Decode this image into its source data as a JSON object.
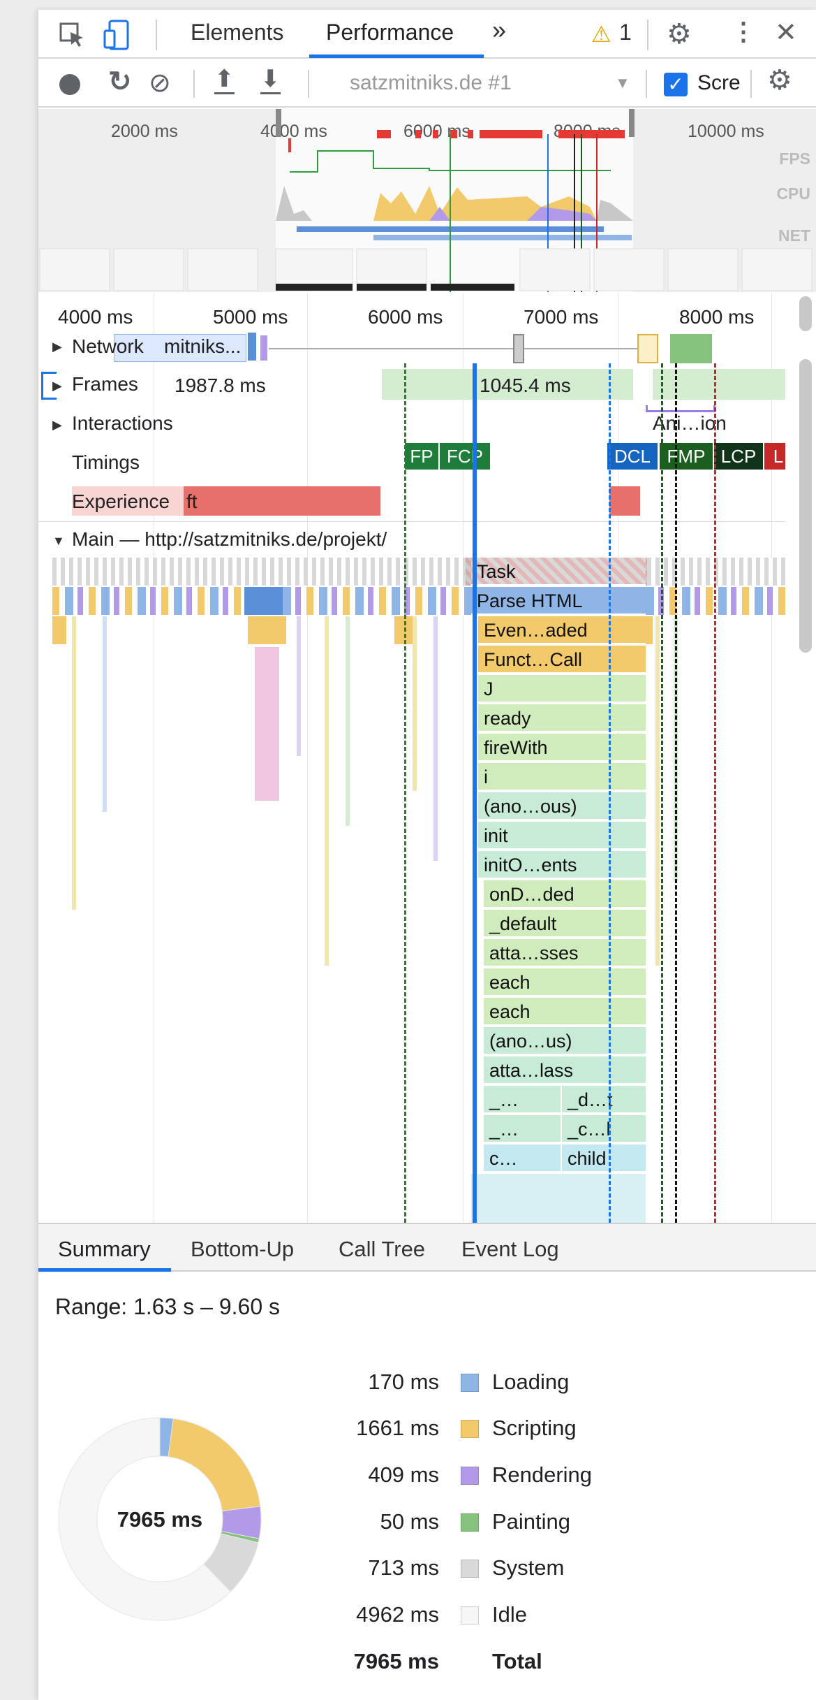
{
  "tabs": {
    "elements": "Elements",
    "performance": "Performance",
    "more": "»",
    "warning_count": "1"
  },
  "toolbar": {
    "recording_select": "satzmitniks.de #1",
    "screenshots_label": "Scre"
  },
  "overview": {
    "ticks": [
      "2000 ms",
      "4000 ms",
      "6000 ms",
      "8000 ms",
      "10000 ms"
    ],
    "lanes": [
      "FPS",
      "CPU",
      "NET"
    ]
  },
  "ruler": {
    "ticks": [
      "4000 ms",
      "5000 ms",
      "6000 ms",
      "7000 ms",
      "8000 ms"
    ]
  },
  "tracks": {
    "network": "Network",
    "network_item": "mitniks...",
    "frames": "Frames",
    "frames_value_1": "1987.8 ms",
    "frames_value_2": "1045.4 ms",
    "interactions": "Interactions",
    "interactions_item": "Ani…ion",
    "timings": "Timings",
    "experience": "Experience",
    "experience_item": "ft",
    "main": "Main — http://satzmitniks.de/projekt/"
  },
  "timing_markers": [
    "FP",
    "FCP",
    "DCL",
    "FMP",
    "LCP",
    "L"
  ],
  "call_stack": [
    "Task",
    "Parse HTML",
    "Even…aded",
    "Funct…Call",
    "J",
    "ready",
    "fireWith",
    "i",
    "(ano…ous)",
    "init",
    "initO…ents",
    "onD…ded",
    "_default",
    "atta…sses",
    "each",
    "each",
    "(ano…us)",
    "atta…lass",
    "_…",
    "_d…t",
    "_…",
    "_c…l",
    "c…",
    "child"
  ],
  "bottom_tabs": [
    "Summary",
    "Bottom-Up",
    "Call Tree",
    "Event Log"
  ],
  "summary": {
    "range": "Range: 1.63 s – 9.60 s",
    "total_center": "7965 ms",
    "rows": [
      {
        "value": "170 ms",
        "name": "Loading",
        "color": "#8fb5e6"
      },
      {
        "value": "1661 ms",
        "name": "Scripting",
        "color": "#f2ca6b"
      },
      {
        "value": "409 ms",
        "name": "Rendering",
        "color": "#b39ae9"
      },
      {
        "value": "50 ms",
        "name": "Painting",
        "color": "#85c27d"
      },
      {
        "value": "713 ms",
        "name": "System",
        "color": "#d9d9d9"
      },
      {
        "value": "4962 ms",
        "name": "Idle",
        "color": "#f6f6f6"
      }
    ],
    "total_value": "7965 ms",
    "total_label": "Total"
  },
  "chart_data": {
    "type": "pie",
    "categories": [
      "Loading",
      "Scripting",
      "Rendering",
      "Painting",
      "System",
      "Idle"
    ],
    "values": [
      170,
      1661,
      409,
      50,
      713,
      4962
    ],
    "title": "7965 ms"
  }
}
